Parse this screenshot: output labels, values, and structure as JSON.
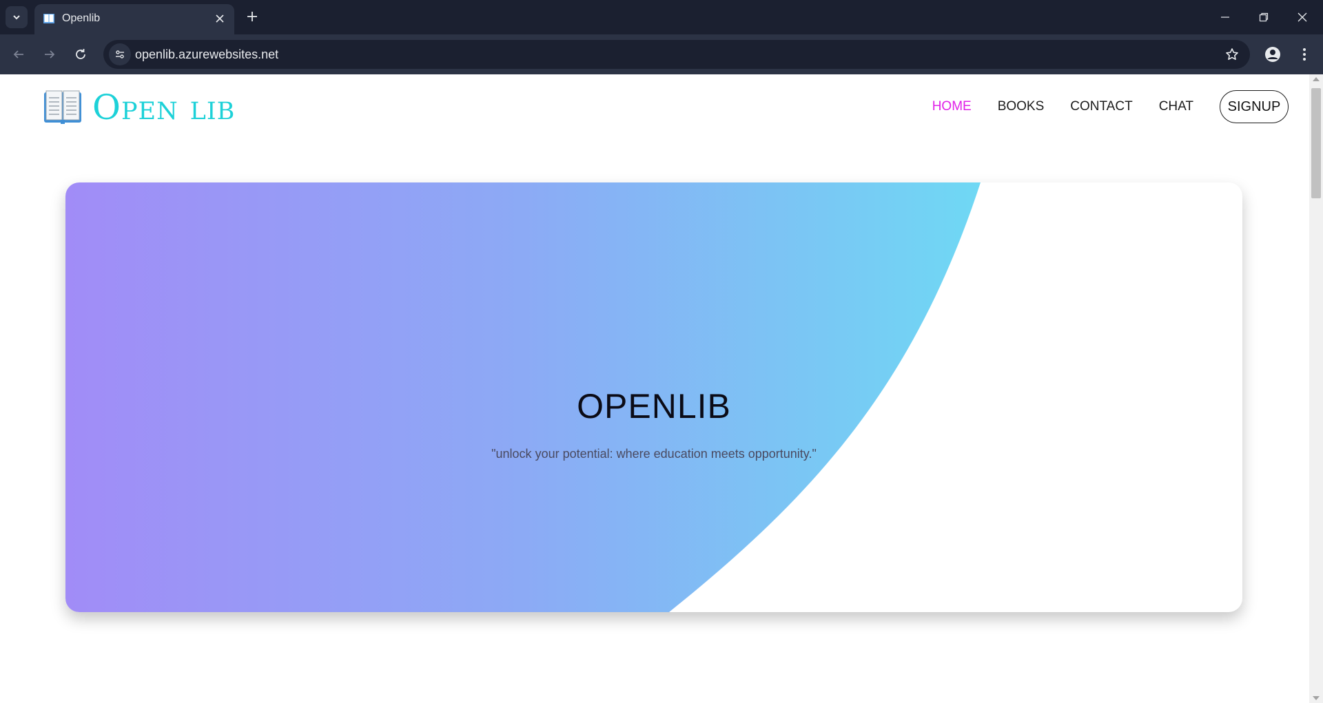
{
  "browser": {
    "tab": {
      "title": "Openlib",
      "favicon": "open-book-icon"
    },
    "address_bar": {
      "url": "openlib.azurewebsites.net"
    },
    "icons": {
      "tab_search": "chevron-down-icon",
      "tab_close": "close-icon",
      "new_tab": "plus-icon",
      "minimize": "minimize-icon",
      "restore": "restore-icon",
      "close": "close-icon",
      "back": "arrow-left-icon",
      "forward": "arrow-right-icon",
      "reload": "reload-icon",
      "site_info": "tune-icon",
      "bookmark": "star-icon",
      "profile": "person-icon",
      "menu": "vertical-dots-icon"
    }
  },
  "header": {
    "logo_text": "Open lib",
    "logo_icon": "open-book-icon",
    "nav": [
      {
        "label": "HOME",
        "active": true
      },
      {
        "label": "BOOKS",
        "active": false
      },
      {
        "label": "CONTACT",
        "active": false
      },
      {
        "label": "CHAT",
        "active": false
      }
    ],
    "signup_label": "SIGNUP"
  },
  "hero": {
    "title": "OPENLIB",
    "tagline": "\"unlock your potential: where education meets opportunity.\""
  },
  "colors": {
    "logo": "#1dd1d8",
    "nav_active": "#e020e8",
    "gradient_start": "#a18cf7",
    "gradient_mid": "#8caaf5",
    "gradient_end": "#6fd8f4",
    "browser_frame": "#1b2030",
    "browser_toolbar": "#2c3345"
  }
}
